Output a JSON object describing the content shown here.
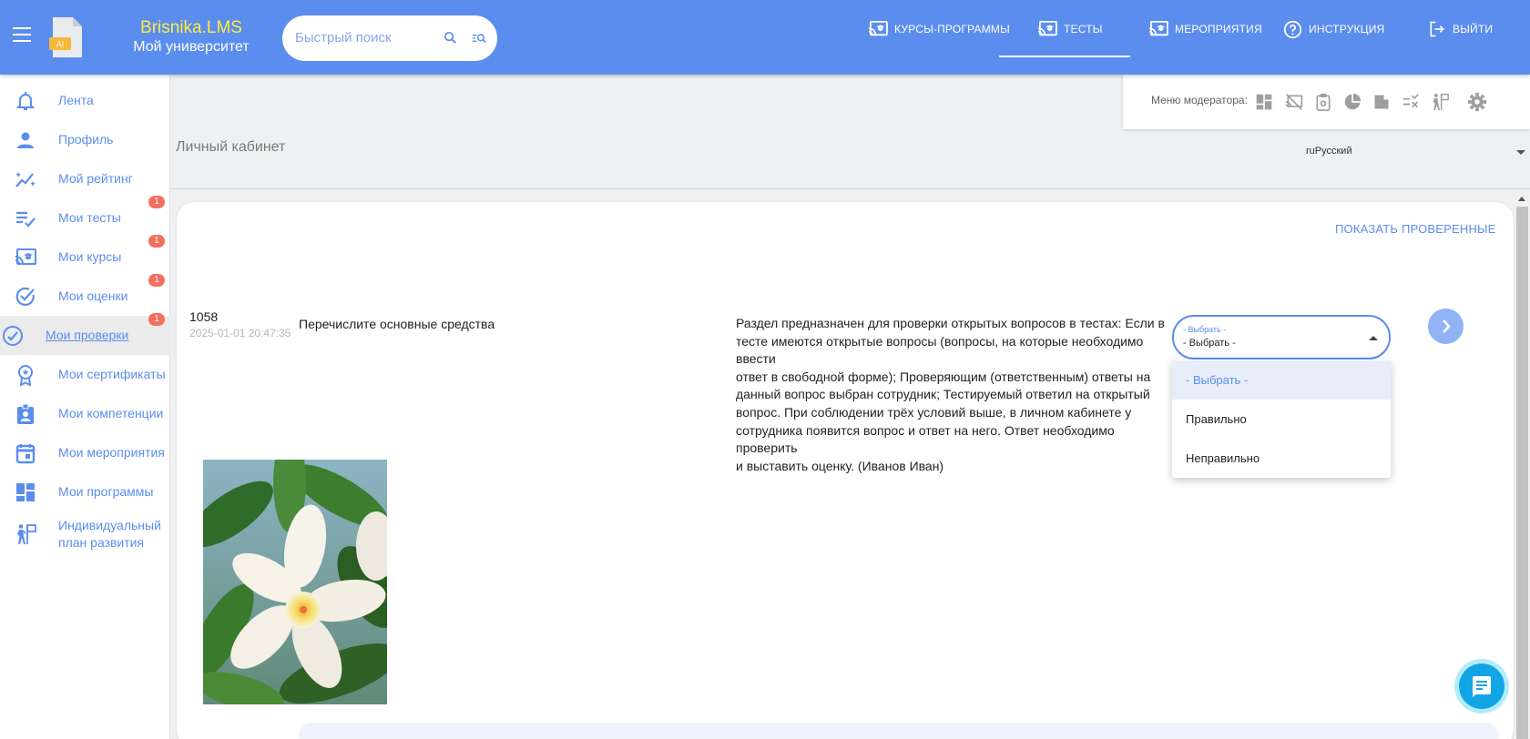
{
  "header": {
    "brand_title": "Brisnika.LMS",
    "brand_subtitle": "Мой университет",
    "logo_text": "AI",
    "search_placeholder": "Быстрый поиск",
    "nav": [
      {
        "label": "КУРСЫ-ПРОГРАММЫ",
        "icon": "cast-education-icon"
      },
      {
        "label": "ТЕСТЫ",
        "icon": "cast-education-icon",
        "active": true
      },
      {
        "label": "МЕРОПРИЯТИЯ",
        "icon": "cast-education-icon"
      },
      {
        "label": "ИНСТРУКЦИЯ",
        "icon": "help-circle-icon"
      },
      {
        "label": "ВЫЙТИ",
        "icon": "logout-icon"
      }
    ]
  },
  "sidebar": {
    "items": [
      {
        "label": "Лента",
        "icon": "bell-icon"
      },
      {
        "label": "Профиль",
        "icon": "person-icon"
      },
      {
        "label": "Мой рейтинг",
        "icon": "rating-chart-icon"
      },
      {
        "label": "Мои тесты",
        "icon": "checklist-icon",
        "badge": "1"
      },
      {
        "label": "Мои курсы",
        "icon": "cast-education-icon",
        "badge": "1"
      },
      {
        "label": "Мои оценки",
        "icon": "check-circle-icon",
        "badge": "1"
      },
      {
        "label": "Мои проверки",
        "icon": "review-icon",
        "badge": "1",
        "active": true
      },
      {
        "label": "Мои сертификаты",
        "icon": "award-icon"
      },
      {
        "label": "Мои компетенции",
        "icon": "badge-clipboard-icon"
      },
      {
        "label": "Мои мероприятия",
        "icon": "calendar-icon"
      },
      {
        "label": "Мои программы",
        "icon": "dashboard-icon"
      },
      {
        "label": "Индивидуальный план развития",
        "label_line1": "Индивидуальный",
        "label_line2": "план развития",
        "icon": "development-plan-icon"
      }
    ]
  },
  "moderator": {
    "label": "Меню модератора:",
    "icons": [
      "dashboard-icon",
      "cast-off-icon",
      "clipboard-icon",
      "pie-chart-icon",
      "note-icon",
      "rule-icon",
      "development-plan-icon",
      "gear-icon"
    ]
  },
  "page": {
    "title": "Личный кабинет",
    "language": "ruРусский",
    "show_checked": "ПОКАЗАТЬ ПРОВЕРЕННЫЕ"
  },
  "review": {
    "id": "1058",
    "date": "2025-01-01 20:47:35",
    "question": "Перечислите основные средства",
    "description_lines": [
      "Раздел предназначен для проверки открытых вопросов в тестах: Если в",
      "тесте имеются открытые вопросы (вопросы, на которые необходимо ввести",
      "ответ в свободной форме); Проверяющим (ответственным) ответы на",
      "данный вопрос выбран сотрудник; Тестируемый ответил на открытый",
      "вопрос. При соблюдении трёх условий выше, в личном кабинете у",
      "сотрудника появится вопрос и ответ на него. Ответ необходимо проверить",
      "и выставить оценку. (Иванов Иван)"
    ],
    "select": {
      "floating_label": "- Выбрать -",
      "value": "- Выбрать -",
      "options": [
        "- Выбрать -",
        "Правильно",
        "Неправильно"
      ],
      "highlighted_index": 0
    }
  },
  "colors": {
    "primary": "#5b8def",
    "brand_yellow": "#ffeb3b",
    "badge": "#f46f5e",
    "chat": "#12a5e6"
  }
}
